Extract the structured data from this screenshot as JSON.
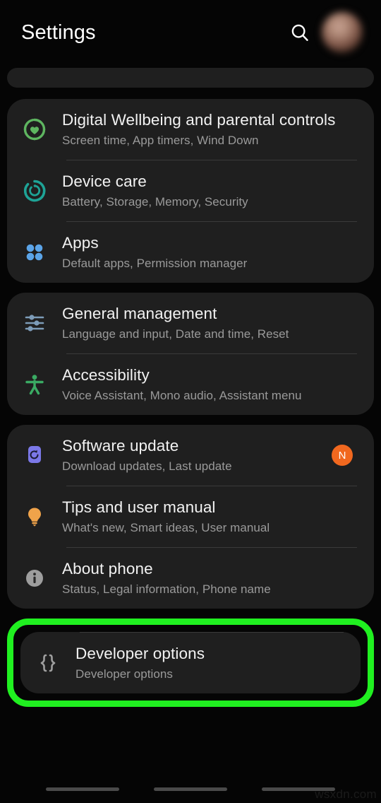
{
  "header": {
    "title": "Settings",
    "search_icon": "search-icon",
    "avatar_label": "profile-avatar"
  },
  "groups": [
    {
      "id": "group-1",
      "items": [
        {
          "title": "Digital Wellbeing and parental controls",
          "subtitle": "Screen time, App timers, Wind Down",
          "icon": "digital-wellbeing-icon",
          "icon_color": "#5eb560",
          "badge": ""
        },
        {
          "title": "Device care",
          "subtitle": "Battery, Storage, Memory, Security",
          "icon": "device-care-icon",
          "icon_color": "#1ea396",
          "badge": ""
        },
        {
          "title": "Apps",
          "subtitle": "Default apps, Permission manager",
          "icon": "apps-icon",
          "icon_color": "#5ba4e8",
          "badge": ""
        }
      ]
    },
    {
      "id": "group-2",
      "items": [
        {
          "title": "General management",
          "subtitle": "Language and input, Date and time, Reset",
          "icon": "sliders-icon",
          "icon_color": "#7d9cb8",
          "badge": ""
        },
        {
          "title": "Accessibility",
          "subtitle": "Voice Assistant, Mono audio, Assistant menu",
          "icon": "accessibility-icon",
          "icon_color": "#3aab63",
          "badge": ""
        }
      ]
    },
    {
      "id": "group-3",
      "items": [
        {
          "title": "Software update",
          "subtitle": "Download updates, Last update",
          "icon": "software-update-icon",
          "icon_color": "#7b78e8",
          "badge": "N"
        },
        {
          "title": "Tips and user manual",
          "subtitle": "What's new, Smart ideas, User manual",
          "icon": "lightbulb-icon",
          "icon_color": "#f0a34a",
          "badge": ""
        },
        {
          "title": "About phone",
          "subtitle": "Status, Legal information, Phone name",
          "icon": "info-icon",
          "icon_color": "#9e9e9e",
          "badge": ""
        }
      ]
    }
  ],
  "highlighted_item": {
    "title": "Developer options",
    "subtitle": "Developer options",
    "icon": "curly-braces-icon",
    "icon_color": "#9e9e9e",
    "highlight_color": "#20f020"
  },
  "navbar": {
    "recents_label": "recents-pill",
    "home_label": "home-pill",
    "back_label": "back-pill"
  },
  "watermark": "wsxdn.com",
  "colors": {
    "background": "#050505",
    "card": "#1f1f1f",
    "title_text": "#f2f2f2",
    "subtitle_text": "#9a9a9a",
    "divider": "#3a3a3a",
    "badge_orange": "#f1681f",
    "highlight_green": "#20f020"
  }
}
